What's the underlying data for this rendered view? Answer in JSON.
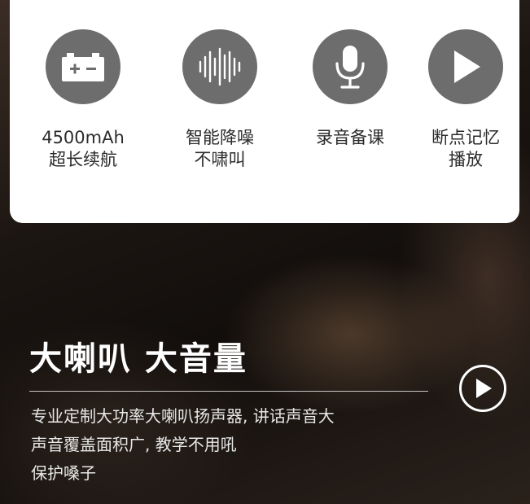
{
  "features": [
    {
      "icon": "battery-icon",
      "line1": "4500mAh",
      "line2": "超长续航"
    },
    {
      "icon": "sound-wave-icon",
      "line1": "智能降噪",
      "line2": "不啸叫"
    },
    {
      "icon": "microphone-icon",
      "line1": "录音备课",
      "line2": ""
    },
    {
      "icon": "play-icon",
      "line1": "断点记忆",
      "line2": "播放"
    }
  ],
  "headline": "大喇叭 大音量",
  "description": {
    "line1": "专业定制大功率大喇叭扬声器, 讲话声音大",
    "line2": "声音覆盖面积广, 教学不用吼",
    "line3": "保护嗓子"
  },
  "colors": {
    "icon_circle": "#6d6d6d",
    "card": "#ffffff",
    "text_light": "#ffffff"
  }
}
